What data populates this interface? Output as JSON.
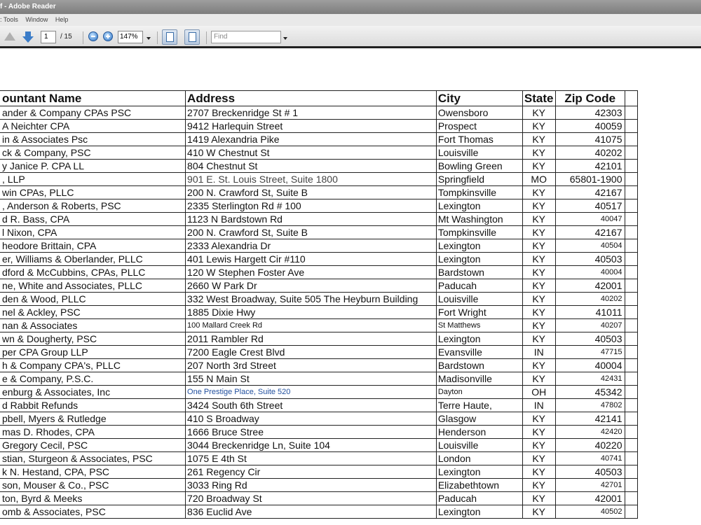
{
  "window": {
    "title": "f - Adobe Reader"
  },
  "menu": {
    "items": [
      ": Tools",
      "Window",
      "Help"
    ]
  },
  "toolbar": {
    "page_current": "1",
    "page_total": "/ 15",
    "zoom": "147%",
    "find_placeholder": "Find"
  },
  "table": {
    "headers": [
      "ountant Name",
      "Address",
      "City",
      "State",
      "Zip Code",
      ""
    ],
    "rows": [
      [
        "ander & Company CPAs PSC",
        "2707 Breckenridge St # 1",
        "Owensboro",
        "KY",
        "42303"
      ],
      [
        "A Neichter CPA",
        "9412 Harlequin Street",
        "Prospect",
        "KY",
        "40059"
      ],
      [
        "in & Associates Psc",
        "1419 Alexandria Pike",
        "Fort Thomas",
        "KY",
        "41075"
      ],
      [
        "ck & Company, PSC",
        "410 W Chestnut St",
        "Louisville",
        "KY",
        "40202"
      ],
      [
        "y Janice P. CPA LL",
        "804 Chestnut St",
        "Bowling Green",
        "KY",
        "42101"
      ],
      [
        ", LLP",
        "901 E. St. Louis Street, Suite 1800",
        "Springfield",
        "MO",
        "65801-1900"
      ],
      [
        "win CPAs, PLLC",
        "200 N. Crawford St, Suite B",
        "Tompkinsville",
        "KY",
        "42167"
      ],
      [
        ", Anderson & Roberts, PSC",
        "2335 Sterlington Rd # 100",
        "Lexington",
        "KY",
        "40517"
      ],
      [
        "d R. Bass, CPA",
        "1123 N Bardstown Rd",
        "Mt Washington",
        "KY",
        "40047"
      ],
      [
        "l Nixon, CPA",
        "200 N. Crawford St, Suite B",
        "Tompkinsville",
        "KY",
        "42167"
      ],
      [
        "heodore Brittain, CPA",
        "2333 Alexandria Dr",
        "Lexington",
        "KY",
        "40504"
      ],
      [
        "er, Williams & Oberlander, PLLC",
        "401 Lewis Hargett Cir #110",
        "Lexington",
        "KY",
        "40503"
      ],
      [
        "dford & McCubbins, CPAs, PLLC",
        "120 W Stephen Foster Ave",
        "Bardstown",
        "KY",
        "40004"
      ],
      [
        "ne, White and Associates, PLLC",
        "2660 W Park Dr",
        "Paducah",
        "KY",
        "42001"
      ],
      [
        "den & Wood, PLLC",
        "332 West Broadway, Suite 505 The Heyburn Building",
        "Louisville",
        "KY",
        "40202"
      ],
      [
        "nel & Ackley, PSC",
        "1885 Dixie Hwy",
        "Fort Wright",
        "KY",
        "41011"
      ],
      [
        "nan & Associates",
        "100 Mallard Creek Rd",
        "St Matthews",
        "KY",
        "40207"
      ],
      [
        "wn & Dougherty, PSC",
        "2011 Rambler Rd",
        "Lexington",
        "KY",
        "40503"
      ],
      [
        "per CPA Group LLP",
        "7200 Eagle Crest Blvd",
        "Evansville",
        "IN",
        "47715"
      ],
      [
        "h & Company CPA's, PLLC",
        "207 North 3rd Street",
        "Bardstown",
        "KY",
        "40004"
      ],
      [
        "e & Company, P.S.C.",
        "155 N Main St",
        "Madisonville",
        "KY",
        "42431"
      ],
      [
        "enburg & Associates, Inc",
        "One Prestige Place, Suite 520",
        "Dayton",
        "OH",
        "45342"
      ],
      [
        "d Rabbit Refunds",
        "3424 South 6th Street",
        "Terre Haute,",
        "IN",
        "47802"
      ],
      [
        "pbell, Myers & Rutledge",
        "410 S Broadway",
        "Glasgow",
        "KY",
        "42141"
      ],
      [
        "mas D. Rhodes, CPA",
        "1666 Bruce Stree",
        "Henderson",
        "KY",
        "42420"
      ],
      [
        "Gregory Cecil, PSC",
        "3044 Breckenridge Ln, Suite 104",
        " Louisville",
        "KY",
        "40220"
      ],
      [
        "stian, Sturgeon & Associates, PSC",
        "1075 E 4th St",
        "London",
        "KY",
        "40741"
      ],
      [
        "k N. Hestand, CPA, PSC",
        "261 Regency Cir",
        "Lexington",
        "KY",
        "40503"
      ],
      [
        "son, Mouser & Co., PSC",
        "3033 Ring Rd",
        "Elizabethtown",
        "KY",
        "42701"
      ],
      [
        "ton, Byrd & Meeks",
        "720 Broadway St",
        "Paducah",
        "KY",
        "42001"
      ],
      [
        "omb & Associates, PSC",
        "836 Euclid Ave",
        "Lexington",
        "KY",
        "40502"
      ]
    ]
  }
}
